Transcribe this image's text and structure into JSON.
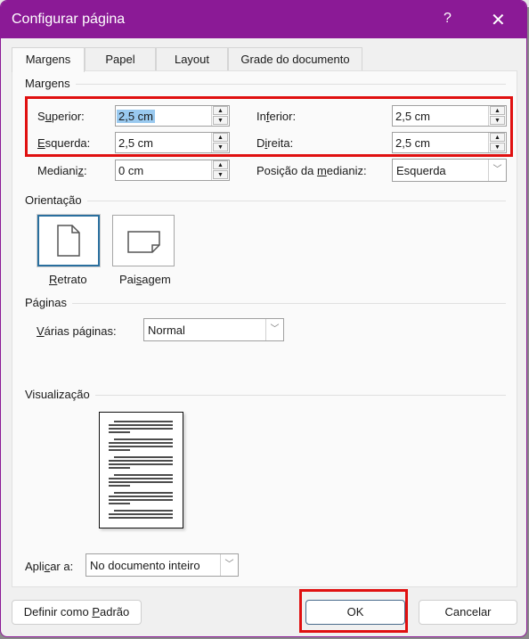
{
  "window": {
    "title": "Configurar página",
    "help_label": "?",
    "close_label": "✕"
  },
  "tabs": [
    {
      "label": "Margens",
      "active": true
    },
    {
      "label": "Papel",
      "active": false
    },
    {
      "label": "Layout",
      "active": false
    },
    {
      "label": "Grade do documento",
      "active": false
    }
  ],
  "margins": {
    "group_label": "Margens",
    "superior": {
      "label_pre": "S",
      "label_u": "u",
      "label_post": "perior:",
      "value": "2,5 cm"
    },
    "inferior": {
      "label_pre": "In",
      "label_u": "f",
      "label_post": "erior:",
      "value": "2,5 cm"
    },
    "esquerda": {
      "label_pre": "",
      "label_u": "E",
      "label_post": "squerda:",
      "value": "2,5 cm"
    },
    "direita": {
      "label_pre": "D",
      "label_u": "i",
      "label_post": "reita:",
      "value": "2,5 cm"
    },
    "medianiz": {
      "label_pre": "Mediani",
      "label_u": "z",
      "label_post": ":",
      "value": "0 cm"
    },
    "posicao": {
      "label_pre": "Posição da ",
      "label_u": "m",
      "label_post": "edianiz:",
      "value": "Esquerda"
    }
  },
  "orientation": {
    "group_label": "Orientação",
    "portrait": {
      "label_u": "R",
      "label_post": "etrato",
      "selected": true
    },
    "landscape": {
      "label_pre": "Pai",
      "label_u": "s",
      "label_post": "agem",
      "selected": false
    }
  },
  "pages": {
    "group_label": "Páginas",
    "multiple": {
      "label_u": "V",
      "label_post": "árias páginas:",
      "value": "Normal"
    }
  },
  "preview": {
    "group_label": "Visualização"
  },
  "apply": {
    "label_pre": "Apli",
    "label_u": "c",
    "label_post": "ar a:",
    "value": "No documento inteiro"
  },
  "buttons": {
    "default_pre": "Definir como ",
    "default_u": "P",
    "default_post": "adrão",
    "ok": "OK",
    "cancel": "Cancelar"
  },
  "icons": {
    "spin_up": "▲",
    "spin_down": "▼",
    "dropdown": "﹀"
  },
  "colors": {
    "titlebar": "#8b1a96",
    "highlight": "#e01010",
    "selection": "#99c9ef"
  }
}
